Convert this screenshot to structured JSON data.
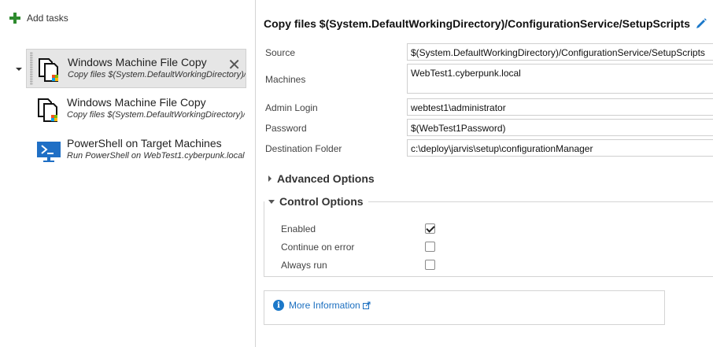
{
  "left": {
    "add_tasks_label": "Add tasks",
    "tasks": [
      {
        "title": "Windows Machine File Copy",
        "subtitle": "Copy files $(System.DefaultWorkingDirectory)/ConfigurationService/SetupScripts",
        "icon": "file-copy-icon",
        "selected": true
      },
      {
        "title": "Windows Machine File Copy",
        "subtitle": "Copy files $(System.DefaultWorkingDirectory)/ConfigurationService/SetupScripts",
        "icon": "file-copy-icon",
        "selected": false
      },
      {
        "title": "PowerShell on Target Machines",
        "subtitle": "Run PowerShell on WebTest1.cyberpunk.local",
        "icon": "powershell-icon",
        "selected": false
      }
    ],
    "close_glyph": "✕"
  },
  "detail": {
    "title": "Copy files $(System.DefaultWorkingDirectory)/ConfigurationService/SetupScripts",
    "fields": [
      {
        "label": "Source",
        "value": "$(System.DefaultWorkingDirectory)/ConfigurationService/SetupScripts"
      },
      {
        "label": "Machines",
        "value": "WebTest1.cyberpunk.local"
      },
      {
        "label": "Admin Login",
        "value": "webtest1\\administrator"
      },
      {
        "label": "Password",
        "value": "$(WebTest1Password)"
      },
      {
        "label": "Destination Folder",
        "value": "c:\\deploy\\jarvis\\setup\\configurationManager"
      }
    ],
    "advanced_options_label": "Advanced Options",
    "control_options_label": "Control Options",
    "control_options": [
      {
        "label": "Enabled",
        "checked": true
      },
      {
        "label": "Continue on error",
        "checked": false
      },
      {
        "label": "Always run",
        "checked": false
      }
    ],
    "more_info_label": "More Information"
  },
  "colors": {
    "accent": "#1b78c9",
    "add_green": "#2e8b2e",
    "selected_bg": "#e6e6e6"
  }
}
